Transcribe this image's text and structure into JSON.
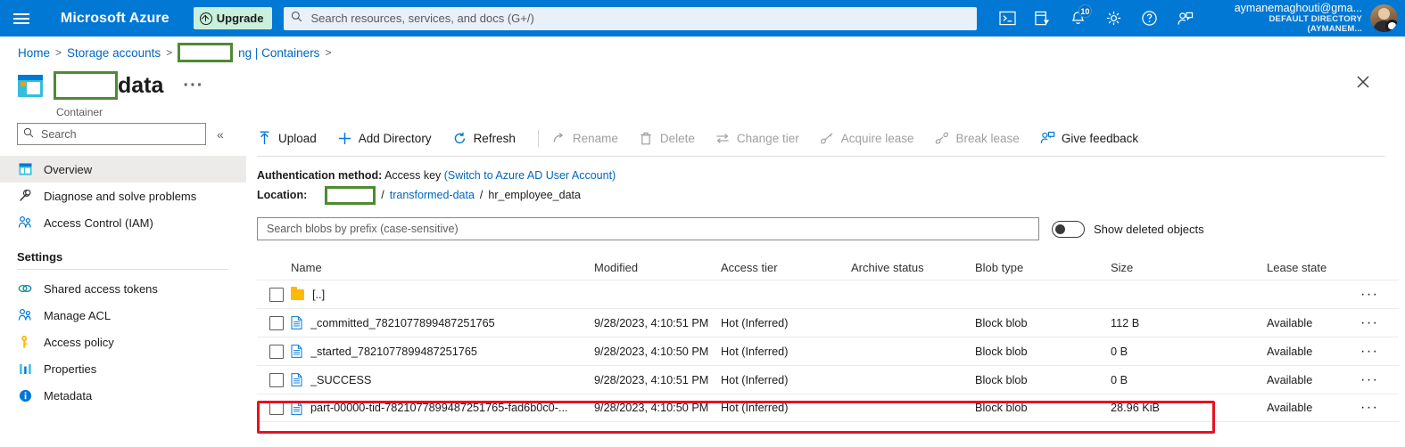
{
  "topbar": {
    "menu_icon": "hamburger-icon",
    "brand": "Microsoft Azure",
    "upgrade_label": "Upgrade",
    "search_placeholder": "Search resources, services, and docs (G+/)",
    "icons": [
      {
        "name": "cloud-shell-icon",
        "label": "Cloud Shell"
      },
      {
        "name": "directories-subscriptions-icon",
        "label": "Directories + subscriptions"
      },
      {
        "name": "notifications-bell-icon",
        "label": "Notifications",
        "badge": "10"
      },
      {
        "name": "settings-gear-icon",
        "label": "Settings"
      },
      {
        "name": "help-question-icon",
        "label": "Help"
      },
      {
        "name": "feedback-person-icon",
        "label": "Feedback"
      }
    ],
    "account_email": "aymanemaghouti@gma...",
    "account_directory": "DEFAULT DIRECTORY (AYMANEM..."
  },
  "breadcrumb": {
    "home": "Home",
    "storage_accounts": "Storage accounts",
    "redacted": "",
    "containers": "ng | Containers",
    "separator": ">"
  },
  "page": {
    "title_redacted": "",
    "title_suffix": "data",
    "subtitle": "Container",
    "ellipsis": "···",
    "close_label": "Close"
  },
  "leftnav": {
    "search_placeholder": "Search",
    "collapse": "«",
    "items": [
      {
        "label": "Overview",
        "icon": "overview-icon",
        "active": true
      },
      {
        "label": "Diagnose and solve problems",
        "icon": "wrench-icon",
        "active": false
      },
      {
        "label": "Access Control (IAM)",
        "icon": "people-icon",
        "active": false
      }
    ],
    "settings_header": "Settings",
    "settings_items": [
      {
        "label": "Shared access tokens",
        "icon": "tokens-icon"
      },
      {
        "label": "Manage ACL",
        "icon": "people-icon"
      },
      {
        "label": "Access policy",
        "icon": "key-icon"
      },
      {
        "label": "Properties",
        "icon": "properties-icon"
      },
      {
        "label": "Metadata",
        "icon": "info-icon"
      }
    ]
  },
  "commandbar": [
    {
      "label": "Upload",
      "icon": "upload-arrow-icon",
      "disabled": false
    },
    {
      "label": "Add Directory",
      "icon": "plus-icon",
      "disabled": false
    },
    {
      "label": "Refresh",
      "icon": "refresh-icon",
      "disabled": false
    },
    {
      "label": "Rename",
      "icon": "rename-icon",
      "disabled": true
    },
    {
      "label": "Delete",
      "icon": "trash-icon",
      "disabled": true
    },
    {
      "label": "Change tier",
      "icon": "change-tier-icon",
      "disabled": true
    },
    {
      "label": "Acquire lease",
      "icon": "lease-icon",
      "disabled": true
    },
    {
      "label": "Break lease",
      "icon": "break-lease-icon",
      "disabled": true
    },
    {
      "label": "Give feedback",
      "icon": "feedback-person-icon",
      "disabled": false
    }
  ],
  "auth": {
    "label": "Authentication method:",
    "value": "Access key",
    "switch_link": "(Switch to Azure AD User Account)"
  },
  "location": {
    "label": "Location:",
    "redacted": "",
    "sep": "/",
    "crumb1": "transformed-data",
    "crumb2": "hr_employee_data"
  },
  "filter": {
    "search_placeholder": "Search blobs by prefix (case-sensitive)",
    "show_deleted_label": "Show deleted objects",
    "show_deleted_on": false
  },
  "table": {
    "columns": [
      "Name",
      "Modified",
      "Access tier",
      "Archive status",
      "Blob type",
      "Size",
      "Lease state"
    ],
    "rows": [
      {
        "name": "[..]",
        "icon": "folder-icon",
        "modified": "",
        "access_tier": "",
        "archive_status": "",
        "blob_type": "",
        "size": "",
        "lease_state": "",
        "more": "···"
      },
      {
        "name": "_committed_7821077899487251765",
        "icon": "file-icon",
        "modified": "9/28/2023, 4:10:51 PM",
        "access_tier": "Hot (Inferred)",
        "archive_status": "",
        "blob_type": "Block blob",
        "size": "112 B",
        "lease_state": "Available",
        "more": "···"
      },
      {
        "name": "_started_7821077899487251765",
        "icon": "file-icon",
        "modified": "9/28/2023, 4:10:50 PM",
        "access_tier": "Hot (Inferred)",
        "archive_status": "",
        "blob_type": "Block blob",
        "size": "0 B",
        "lease_state": "Available",
        "more": "···"
      },
      {
        "name": "_SUCCESS",
        "icon": "file-icon",
        "modified": "9/28/2023, 4:10:51 PM",
        "access_tier": "Hot (Inferred)",
        "archive_status": "",
        "blob_type": "Block blob",
        "size": "0 B",
        "lease_state": "Available",
        "more": "···"
      },
      {
        "name": "part-00000-tid-7821077899487251765-fad6b0c0-...",
        "icon": "file-icon",
        "modified": "9/28/2023, 4:10:50 PM",
        "access_tier": "Hot (Inferred)",
        "archive_status": "",
        "blob_type": "Block blob",
        "size": "28.96 KiB",
        "lease_state": "Available",
        "more": "···",
        "highlighted": true
      }
    ]
  },
  "annotations": {
    "highlight_color": "#e81123",
    "redaction_color": "#4e8a35"
  }
}
